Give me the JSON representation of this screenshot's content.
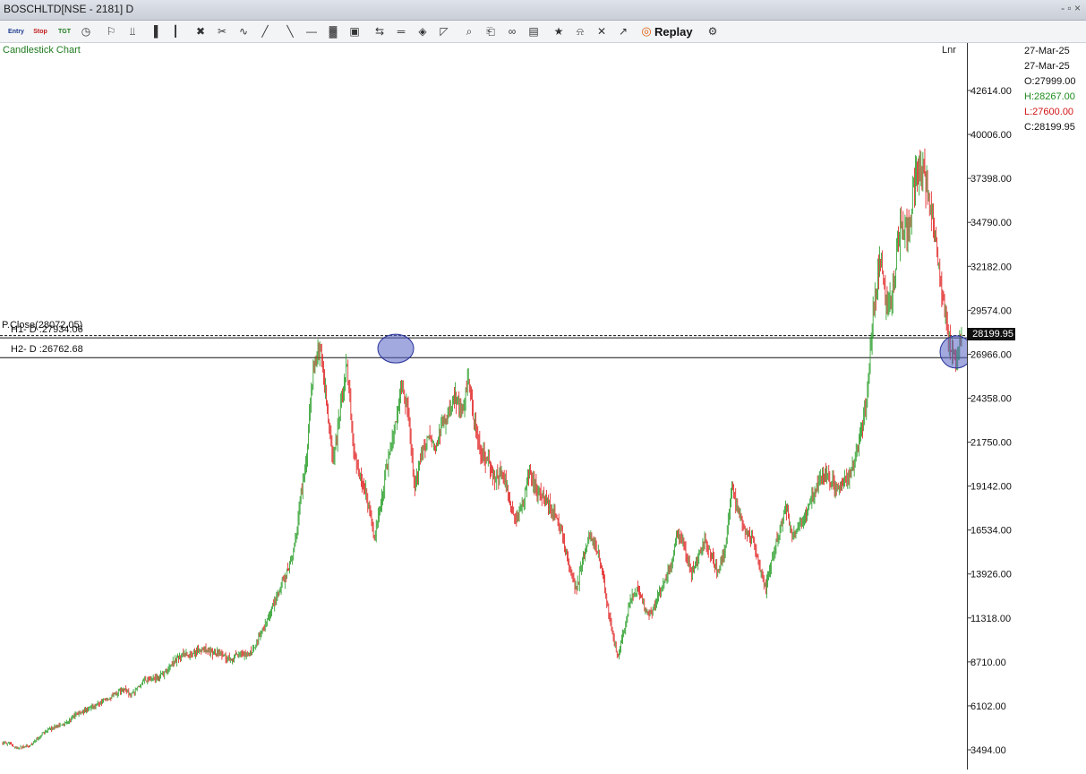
{
  "window": {
    "title": "BOSCHLTD[NSE - 2181] D",
    "controls": "- ▫ ×"
  },
  "toolbar": {
    "entry_label": "Entry",
    "stop_label": "Stop",
    "tgt_label": "TGT",
    "replay_label": "Replay",
    "icons": [
      "entry-icon",
      "stop-icon",
      "target-icon",
      "clock-icon",
      "pin-icon",
      "indicator-icon",
      "bar-chart-icon",
      "candle-icon",
      "crosshair-icon",
      "scissors-icon",
      "wave-icon",
      "ruler-icon",
      "trendline-icon",
      "horizontal-line-icon",
      "volume-icon",
      "cube-icon",
      "flip-icon",
      "lines-icon",
      "tag-icon",
      "bell-draw-icon",
      "zoom-icon",
      "document-icon",
      "link-icon",
      "layout-icon",
      "star-icon",
      "alert-icon",
      "delete-icon",
      "line-chart-icon",
      "replay-icon",
      "settings-icon"
    ]
  },
  "chart": {
    "title": "Candlestick Chart",
    "scale_mode": "Lnr",
    "date_top": "27-Mar-25",
    "date_bottom": "27-Mar-25",
    "open": "O:27999.00",
    "high": "H:28267.00",
    "low": "L:27600.00",
    "close": "C:28199.95",
    "prev_close_label": "P.Close(28072.05)",
    "h1_label": "H1- D :27934.06",
    "h2_label": "H2- D :26762.68",
    "current_price": "28199.95",
    "colors": {
      "up": "#1f9a1f",
      "down": "#e01818",
      "title": "#1e7a1e",
      "high": "#1e8c1e",
      "low": "#d11414",
      "highlight": "#5563c4"
    }
  },
  "chart_data": {
    "type": "candlestick",
    "symbol": "BOSCHLTD",
    "exchange": "NSE",
    "interval": "D",
    "ylim": [
      3494,
      42614
    ],
    "y_ticks": [
      42614.0,
      40006.0,
      37398.0,
      34790.0,
      32182.0,
      29574.0,
      26966.0,
      24358.0,
      21750.0,
      19142.0,
      16534.0,
      13926.0,
      11318.0,
      8710.0,
      6102.0,
      3494.0
    ],
    "y_tick_labels": [
      "42614.00",
      "40006.00",
      "37398.00",
      "34790.00",
      "32182.00",
      "29574.00",
      "26966.00",
      "24358.00",
      "21750.00",
      "19142.00",
      "16534.00",
      "13926.00",
      "11318.00",
      "8710.00",
      "6102.00",
      "3494.00"
    ],
    "last_bar": {
      "date": "27-Mar-25",
      "open": 27999.0,
      "high": 28267.0,
      "low": 27600.0,
      "close": 28199.95
    },
    "horizontal_levels": [
      {
        "name": "P.Close",
        "value": 28072.05,
        "style": "dashed"
      },
      {
        "name": "H1- D",
        "value": 27934.06,
        "style": "solid"
      },
      {
        "name": "H2- D",
        "value": 26762.68,
        "style": "solid"
      }
    ],
    "price_path": [
      [
        0,
        3900
      ],
      [
        1,
        3850
      ],
      [
        2,
        3600
      ],
      [
        3,
        3650
      ],
      [
        4,
        3720
      ],
      [
        5,
        4100
      ],
      [
        6,
        4500
      ],
      [
        7,
        4700
      ],
      [
        8,
        4900
      ],
      [
        9,
        5000
      ],
      [
        10,
        5300
      ],
      [
        11,
        5600
      ],
      [
        12,
        5800
      ],
      [
        13,
        6000
      ],
      [
        14,
        6200
      ],
      [
        15,
        6400
      ],
      [
        16,
        6600
      ],
      [
        17,
        6900
      ],
      [
        18,
        7100
      ],
      [
        19,
        6700
      ],
      [
        20,
        7200
      ],
      [
        21,
        7600
      ],
      [
        22,
        7600
      ],
      [
        23,
        7800
      ],
      [
        24,
        8000
      ],
      [
        25,
        8600
      ],
      [
        26,
        9000
      ],
      [
        27,
        9200
      ],
      [
        28,
        9000
      ],
      [
        29,
        9400
      ],
      [
        30,
        9500
      ],
      [
        31,
        9200
      ],
      [
        32,
        9300
      ],
      [
        33,
        9000
      ],
      [
        34,
        8900
      ],
      [
        35,
        9200
      ],
      [
        36,
        9100
      ],
      [
        37,
        9400
      ],
      [
        38,
        10200
      ],
      [
        39,
        11000
      ],
      [
        40,
        12000
      ],
      [
        41,
        13000
      ],
      [
        42,
        14000
      ],
      [
        43,
        15000
      ],
      [
        44,
        18000
      ],
      [
        45,
        21000
      ],
      [
        46,
        26000
      ],
      [
        47,
        27200
      ],
      [
        48,
        24000
      ],
      [
        49,
        20500
      ],
      [
        50,
        24000
      ],
      [
        51,
        26400
      ],
      [
        52,
        21000
      ],
      [
        53,
        19500
      ],
      [
        54,
        18500
      ],
      [
        55,
        16000
      ],
      [
        56,
        18000
      ],
      [
        57,
        20500
      ],
      [
        58,
        22500
      ],
      [
        59,
        25000
      ],
      [
        60,
        23500
      ],
      [
        61,
        19000
      ],
      [
        62,
        21000
      ],
      [
        63,
        22000
      ],
      [
        64,
        21500
      ],
      [
        65,
        22500
      ],
      [
        66,
        23500
      ],
      [
        67,
        24500
      ],
      [
        68,
        23500
      ],
      [
        69,
        25500
      ],
      [
        70,
        22500
      ],
      [
        71,
        21000
      ],
      [
        72,
        20500
      ],
      [
        73,
        19500
      ],
      [
        74,
        20000
      ],
      [
        75,
        18500
      ],
      [
        76,
        17200
      ],
      [
        77,
        18000
      ],
      [
        78,
        20000
      ],
      [
        79,
        19000
      ],
      [
        80,
        18500
      ],
      [
        81,
        18000
      ],
      [
        82,
        17500
      ],
      [
        83,
        16000
      ],
      [
        84,
        14000
      ],
      [
        85,
        13000
      ],
      [
        86,
        15000
      ],
      [
        87,
        16500
      ],
      [
        88,
        15500
      ],
      [
        89,
        13500
      ],
      [
        90,
        11000
      ],
      [
        91,
        9000
      ],
      [
        92,
        10500
      ],
      [
        93,
        12500
      ],
      [
        94,
        13000
      ],
      [
        95,
        12000
      ],
      [
        96,
        11500
      ],
      [
        97,
        12500
      ],
      [
        98,
        13500
      ],
      [
        99,
        14500
      ],
      [
        100,
        16500
      ],
      [
        101,
        15500
      ],
      [
        102,
        14000
      ],
      [
        103,
        15000
      ],
      [
        104,
        16000
      ],
      [
        105,
        15000
      ],
      [
        106,
        14000
      ],
      [
        107,
        15500
      ],
      [
        108,
        19000
      ],
      [
        109,
        17500
      ],
      [
        110,
        16500
      ],
      [
        111,
        16000
      ],
      [
        112,
        14500
      ],
      [
        113,
        13000
      ],
      [
        114,
        15000
      ],
      [
        115,
        16500
      ],
      [
        116,
        18000
      ],
      [
        117,
        16000
      ],
      [
        118,
        17000
      ],
      [
        119,
        17500
      ],
      [
        120,
        18500
      ],
      [
        121,
        19500
      ],
      [
        122,
        20000
      ],
      [
        123,
        19200
      ],
      [
        124,
        19000
      ],
      [
        125,
        19500
      ],
      [
        126,
        20500
      ],
      [
        127,
        22000
      ],
      [
        128,
        24500
      ],
      [
        129,
        30000
      ],
      [
        130,
        32500
      ],
      [
        131,
        29500
      ],
      [
        132,
        31000
      ],
      [
        133,
        35000
      ],
      [
        134,
        34000
      ],
      [
        135,
        37000
      ],
      [
        136,
        38500
      ],
      [
        137,
        36500
      ],
      [
        138,
        34000
      ],
      [
        139,
        31000
      ],
      [
        140,
        28000
      ],
      [
        141,
        26500
      ],
      [
        142,
        28200
      ]
    ]
  }
}
